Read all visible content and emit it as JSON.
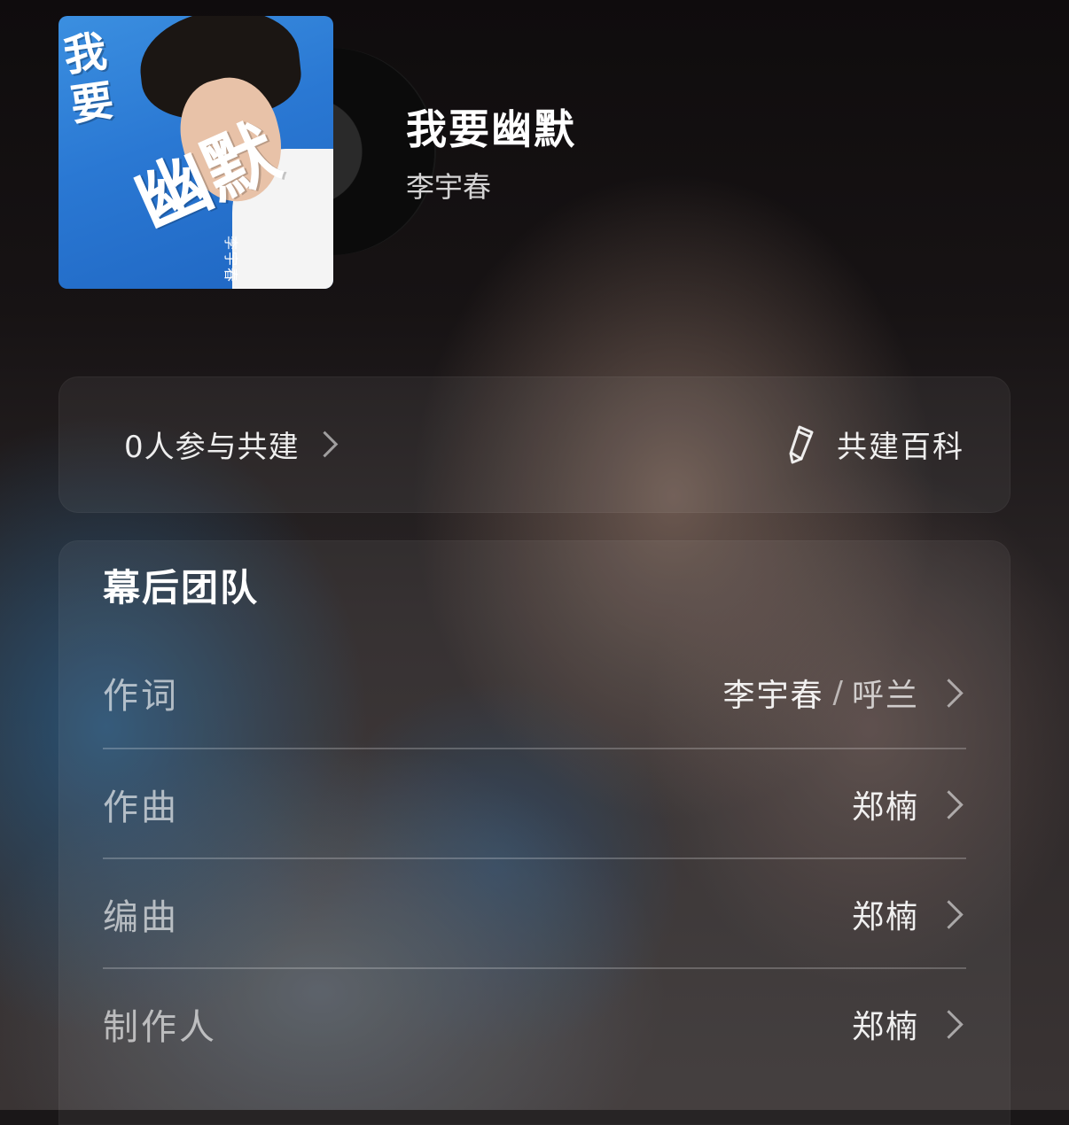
{
  "song": {
    "title": "我要幽默",
    "artist": "李宇春",
    "cover": {
      "title_small": "我要",
      "title_big": "幽默",
      "artist": "李宇春"
    }
  },
  "cobuild": {
    "count_label": "0人参与共建",
    "wiki_label": "共建百科",
    "icons": [
      "chevron-right-icon",
      "pencil-icon"
    ]
  },
  "team": {
    "title": "幕后团队",
    "rows": [
      {
        "role": "作词",
        "people": [
          "李宇春",
          "呼兰"
        ],
        "separator": "/"
      },
      {
        "role": "作曲",
        "people": [
          "郑楠"
        ]
      },
      {
        "role": "编曲",
        "people": [
          "郑楠"
        ]
      },
      {
        "role": "制作人",
        "people": [
          "郑楠"
        ]
      }
    ]
  },
  "colors": {
    "text_primary": "#ffffff",
    "text_secondary": "#b8b3b2",
    "cover_blue": "#2a78d3",
    "card_bg": "rgba(255,255,255,0.06)"
  }
}
